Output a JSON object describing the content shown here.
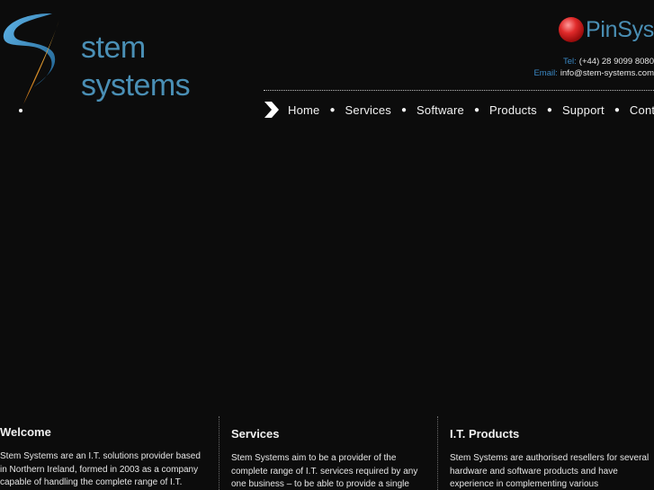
{
  "logo": {
    "line1": "stem",
    "line2": "systems",
    "mark_icon": "swoosh-s-logo-icon",
    "colors": {
      "wordmark": "#4a8fb5",
      "swoosh": "#3d8fc2",
      "flare": "#e8a020"
    }
  },
  "partner": {
    "name": "PinSys",
    "icon": "red-sphere-icon",
    "colors": {
      "sphere": "#e02a2a",
      "text": "#4a8fb5"
    }
  },
  "contact": {
    "tel_label": "Tel:",
    "tel_value": "(+44) 28 9099 8080",
    "email_label": "Email:",
    "email_value": "info@stem-systems.com"
  },
  "nav": {
    "arrow_icon": "chevron-right-icon",
    "items": [
      "Home",
      "Services",
      "Software",
      "Products",
      "Support",
      "Contact"
    ]
  },
  "columns": [
    {
      "title": "Welcome",
      "body": "Stem Systems are an I.T. solutions provider based in Northern Ireland, formed in 2003 as a company capable of handling the complete range of I.T."
    },
    {
      "title": "Services",
      "body": "Stem Systems aim to be a provider of the complete range of I.T. services required by any one business – to be able to provide a single"
    },
    {
      "title": "I.T. Products",
      "body": "Stem Systems are authorised resellers for several hardware and software products and have experience in complementing various"
    }
  ],
  "theme": {
    "background": "#0c0c0c",
    "accent": "#3a88c4",
    "text": "#f2f2f2"
  }
}
